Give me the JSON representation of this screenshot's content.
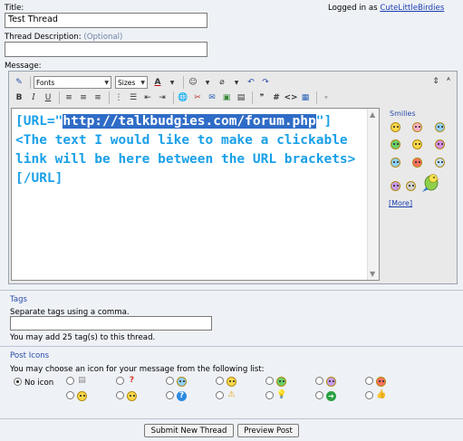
{
  "form": {
    "title_label": "Title:",
    "title_value": "Test Thread",
    "logged_in_prefix": "Logged in as",
    "username": "CuteLittleBirdies",
    "desc_label": "Thread Description:",
    "desc_optional": "(Optional)",
    "desc_value": "",
    "message_label": "Message:"
  },
  "toolbar": {
    "font_select": "Fonts",
    "size_select": "Sizes",
    "color_label": "A",
    "bold": "B",
    "italic": "I",
    "underline": "U",
    "code_label": "<>",
    "hash_label": "#"
  },
  "editor": {
    "text_before": "[URL=\"",
    "text_highlight": "http://talkbudgies.com/forum.php",
    "text_after": "\"]\n<The text I would like to make a clickable link will be here between the URL brackets>\n[/URL]"
  },
  "smilies": {
    "title": "Smilies",
    "more": "[More]"
  },
  "tags": {
    "heading": "Tags",
    "instruction": "Separate tags using a comma.",
    "value": "",
    "note": "You may add 25 tag(s) to this thread."
  },
  "post_icons": {
    "heading": "Post Icons",
    "instruction": "You may choose an icon for your message from the following list:",
    "no_icon": "No icon"
  },
  "buttons": {
    "submit": "Submit New Thread",
    "preview": "Preview Post"
  },
  "colors": {
    "editor_text": "#1aa0e8",
    "selection": "#2f6cc7",
    "link": "#1a3fb0",
    "muted": "#6f86a6",
    "background": "#eef1f6"
  }
}
